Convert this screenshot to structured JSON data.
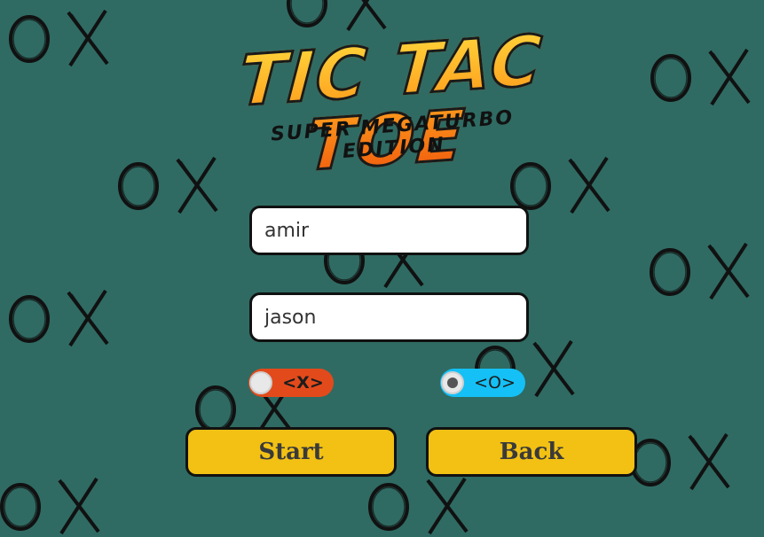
{
  "logo": {
    "title": "TIC TAC TOE",
    "subtitle": "SUPER MEGATURBO EDITION"
  },
  "players": {
    "player1_name": "amir",
    "player2_name": "jason"
  },
  "symbols": {
    "x_label": "<X>",
    "o_label": "<O>"
  },
  "buttons": {
    "start_label": "Start",
    "back_label": "Back"
  },
  "colors": {
    "background": "#2f6b63",
    "button": "#f2c113",
    "x_toggle": "#e34a1b",
    "o_toggle": "#14c0f5"
  },
  "icons": [
    "o-mark-icon",
    "x-mark-icon"
  ]
}
